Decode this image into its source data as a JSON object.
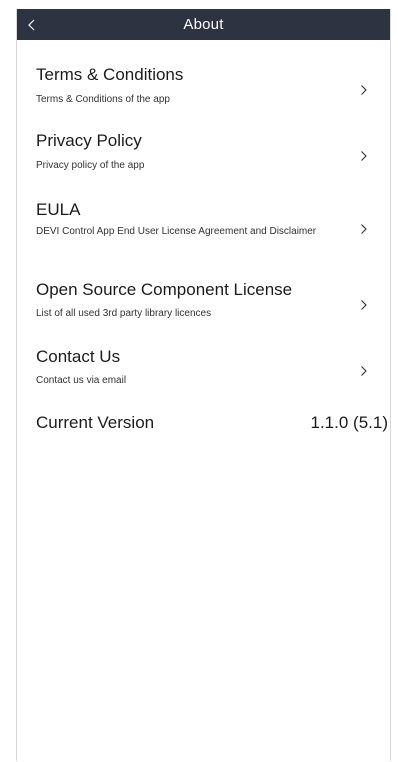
{
  "header": {
    "title": "About",
    "back_icon": "chevron-left-icon"
  },
  "items": [
    {
      "title": "Terms & Conditions",
      "subtitle": "Terms & Conditions of the app"
    },
    {
      "title": "Privacy Policy",
      "subtitle": "Privacy policy of the app"
    },
    {
      "title": "EULA",
      "subtitle": "DEVI Control App End User License Agreement and Disclaimer"
    },
    {
      "title": "Open Source Component License",
      "subtitle": "List of all used 3rd party library licences"
    },
    {
      "title": "Contact Us",
      "subtitle": "Contact us via email"
    }
  ],
  "version": {
    "label": "Current Version",
    "value": "1.1.0 (5.1)"
  },
  "colors": {
    "header_bg": "#2d3340",
    "header_text": "#ffffff",
    "text": "#1c1c1c"
  }
}
